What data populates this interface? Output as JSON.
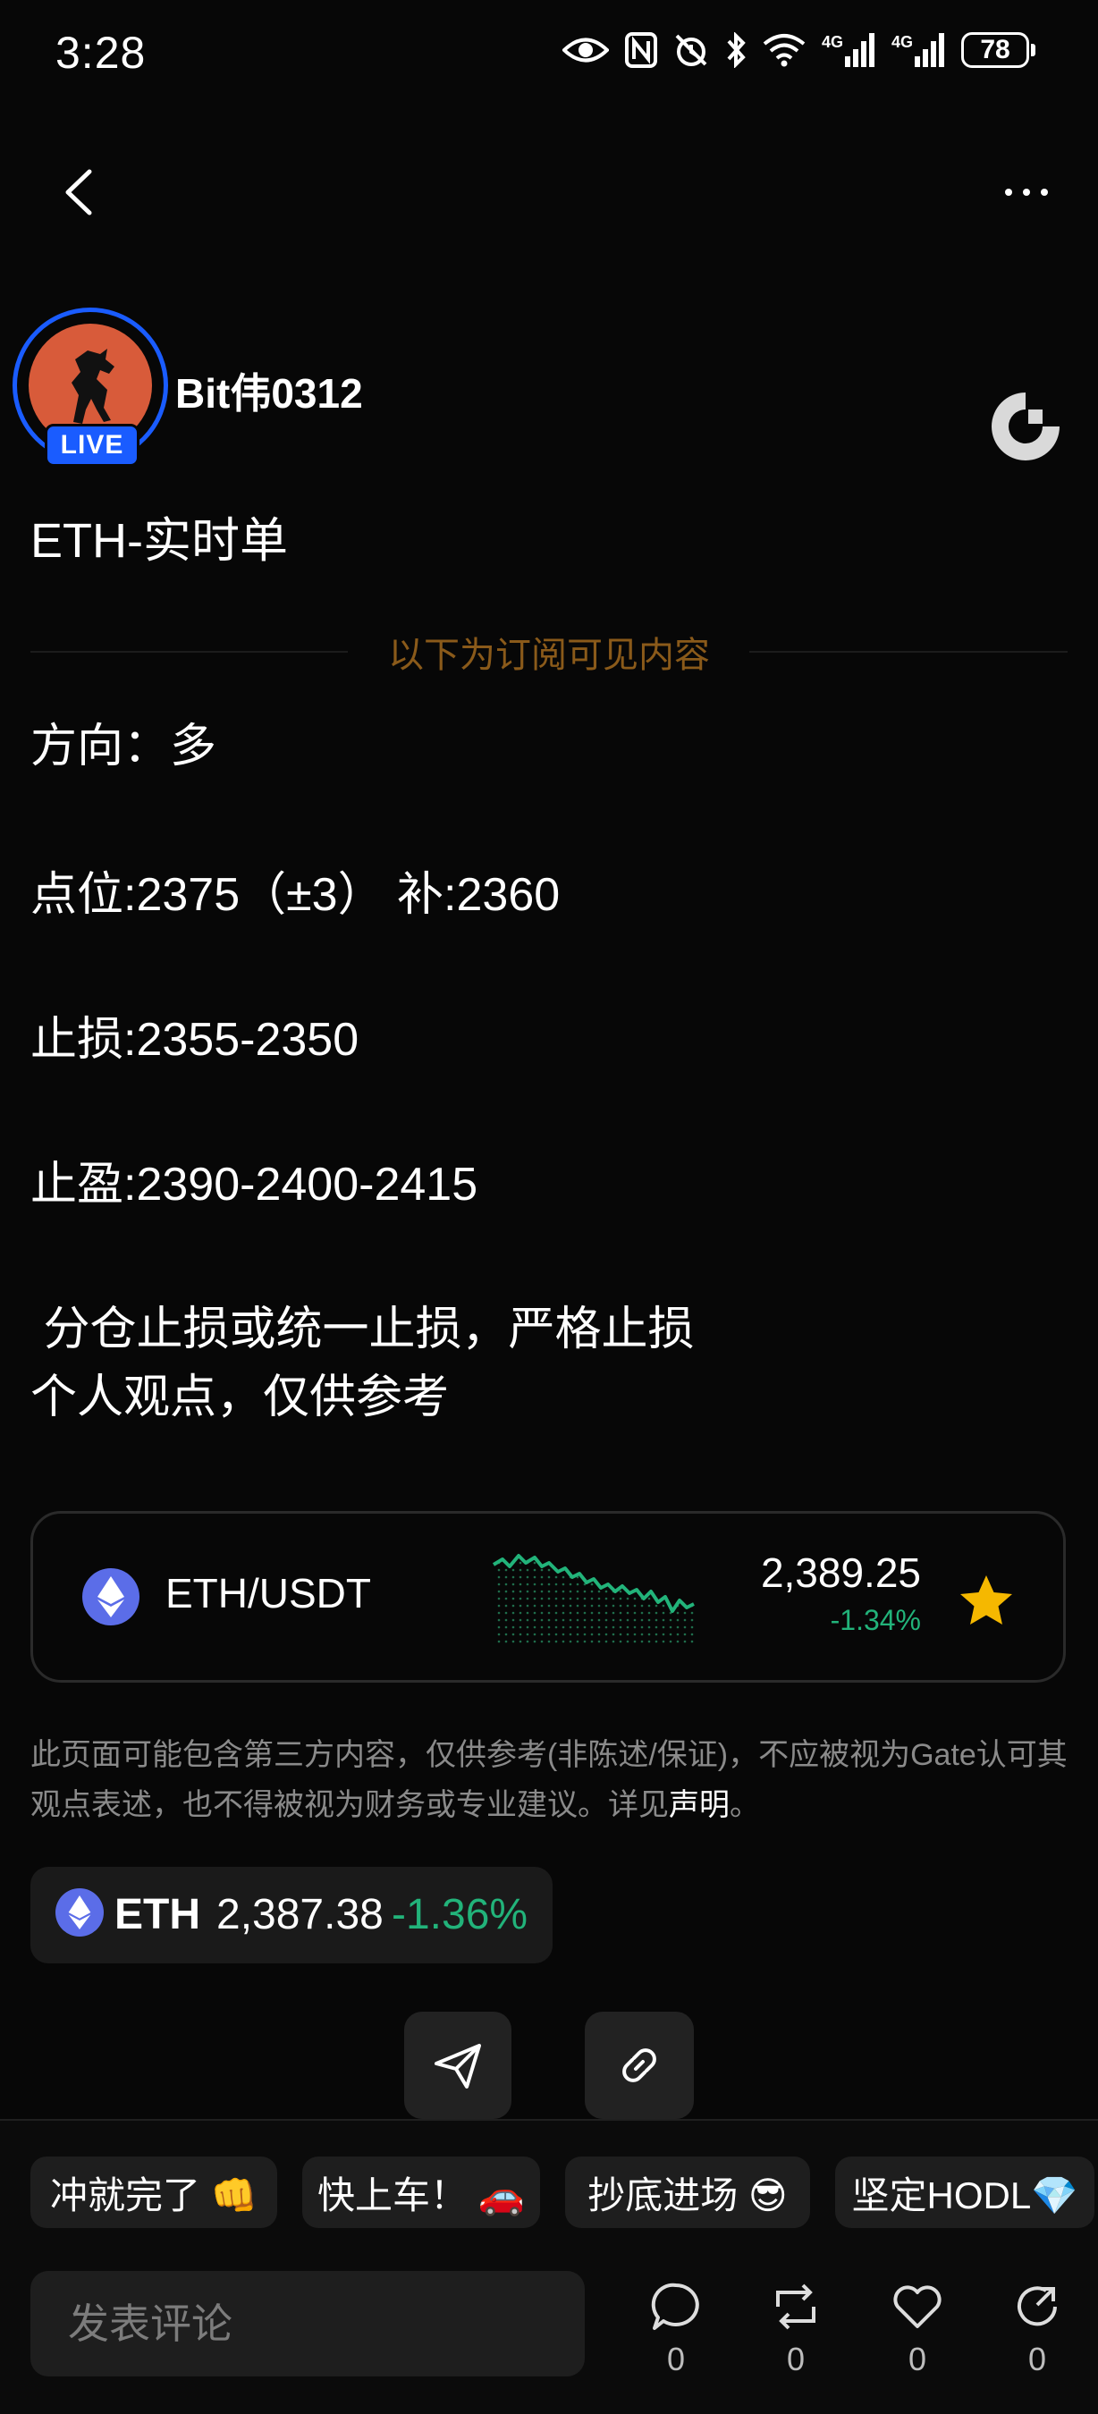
{
  "status_bar": {
    "time": "3:28",
    "network_1": "4G",
    "network_2": "4G",
    "battery": "78"
  },
  "author": {
    "name": "Bit伟0312",
    "live_badge": "LIVE"
  },
  "post": {
    "title": "ETH-实时单",
    "divider_text": "以下为订阅可见内容",
    "lines": [
      "方向：多",
      "点位:2375（±3） 补:2360",
      "止损:2355-2350",
      "止盈:2390-2400-2415",
      " 分仓止损或统一止损，严格止损",
      "个人观点，仅供参考"
    ]
  },
  "ticker_card": {
    "pair": "ETH/USDT",
    "price": "2,389.25",
    "change": "-1.34%"
  },
  "disclaimer": {
    "text": "此页面可能包含第三方内容，仅供参考(非陈述/保证)，不应被视为Gate认可其观点表述，也不得被视为财务或专业建议。详见",
    "link": "声明",
    "end": "。"
  },
  "coin_chip": {
    "symbol": "ETH",
    "price": "2,387.38",
    "change": "-1.36%"
  },
  "quick_replies": [
    "冲就完了 👊",
    "快上车！ 🚗",
    "抄底进场 😎",
    "坚定HODL💎"
  ],
  "comment": {
    "placeholder": "发表评论"
  },
  "actions": {
    "comments": "0",
    "reposts": "0",
    "likes": "0",
    "shares": "0"
  },
  "colors": {
    "accent_blue": "#1a5cff",
    "positive_green": "#22b37a",
    "divider_text": "#8a5a1a",
    "star": "#f5b800"
  }
}
